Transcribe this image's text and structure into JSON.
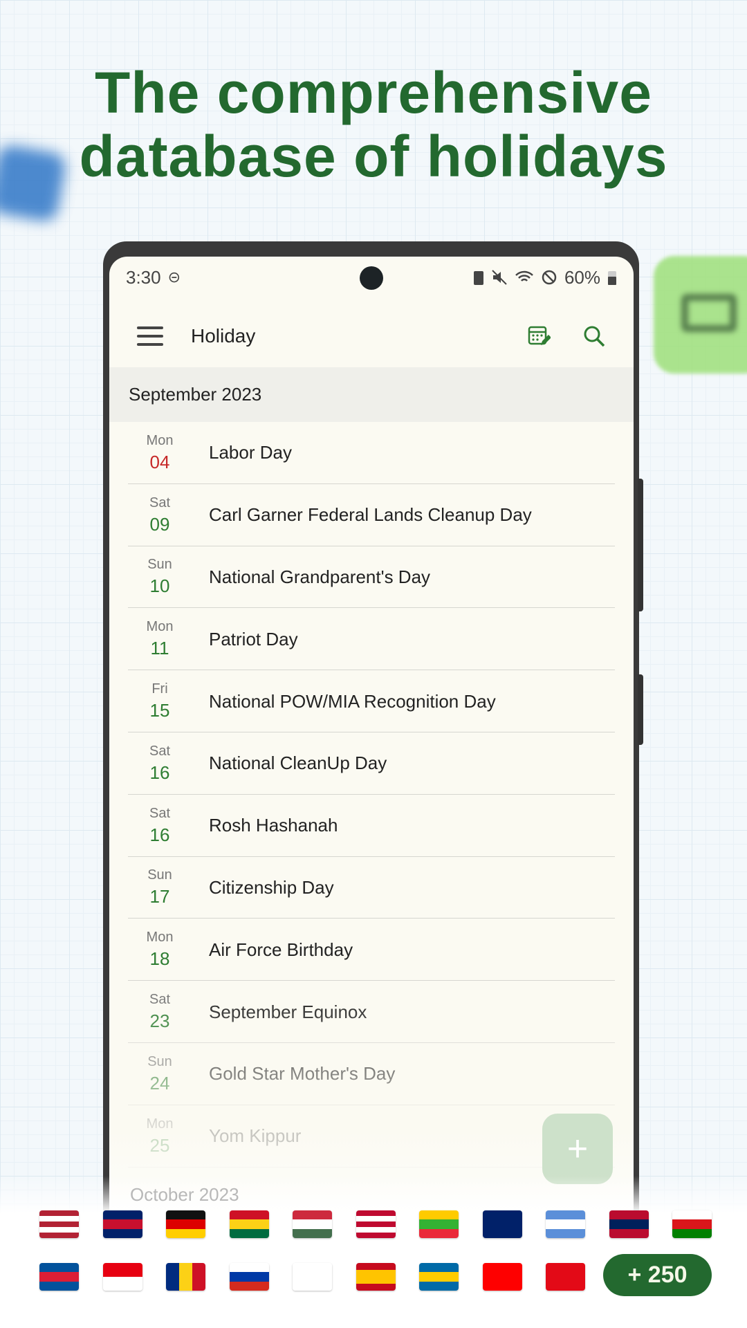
{
  "headline": [
    "The comprehensive",
    "database of holidays"
  ],
  "status": {
    "time": "3:30",
    "battery": "60%"
  },
  "toolbar": {
    "title": "Holiday"
  },
  "section": "September 2023",
  "holidays": [
    {
      "dow": "Mon",
      "day": "04",
      "name": "Labor Day",
      "red": true
    },
    {
      "dow": "Sat",
      "day": "09",
      "name": "Carl Garner Federal Lands Cleanup Day"
    },
    {
      "dow": "Sun",
      "day": "10",
      "name": "National Grandparent's Day"
    },
    {
      "dow": "Mon",
      "day": "11",
      "name": "Patriot Day"
    },
    {
      "dow": "Fri",
      "day": "15",
      "name": "National POW/MIA Recognition Day"
    },
    {
      "dow": "Sat",
      "day": "16",
      "name": "National CleanUp Day"
    },
    {
      "dow": "Sat",
      "day": "16",
      "name": "Rosh Hashanah"
    },
    {
      "dow": "Sun",
      "day": "17",
      "name": "Citizenship Day"
    },
    {
      "dow": "Mon",
      "day": "18",
      "name": "Air Force Birthday"
    },
    {
      "dow": "Sat",
      "day": "23",
      "name": "September Equinox"
    },
    {
      "dow": "Sun",
      "day": "24",
      "name": "Gold Star Mother's Day"
    },
    {
      "dow": "Mon",
      "day": "25",
      "name": "Yom Kippur"
    }
  ],
  "next_section": "October 2023",
  "fab": "+",
  "colors": {
    "accent": "#23692f",
    "weekend_red": "#c62828"
  },
  "flags": [
    [
      {
        "icon": "flag-us",
        "dir": "h",
        "c": [
          "#b22234",
          "#fff",
          "#b22234",
          "#fff",
          "#b22234"
        ]
      },
      {
        "icon": "flag-gb",
        "dir": "h",
        "c": [
          "#012169",
          "#c8102e",
          "#012169"
        ]
      },
      {
        "icon": "flag-de",
        "dir": "h",
        "c": [
          "#111",
          "#dd0000",
          "#ffce00"
        ]
      },
      {
        "icon": "flag-gh",
        "dir": "h",
        "c": [
          "#ce1126",
          "#fcd116",
          "#006b3f"
        ]
      },
      {
        "icon": "flag-hu",
        "dir": "h",
        "c": [
          "#cd2a3e",
          "#fff",
          "#436f4d"
        ]
      },
      {
        "icon": "flag-lr",
        "dir": "h",
        "c": [
          "#bf0a30",
          "#fff",
          "#bf0a30",
          "#fff",
          "#bf0a30"
        ]
      },
      {
        "icon": "flag-mm",
        "dir": "h",
        "c": [
          "#fecb00",
          "#34b233",
          "#ea2839"
        ]
      },
      {
        "icon": "flag-nz",
        "dir": "h",
        "c": [
          "#012169",
          "#012169"
        ]
      },
      {
        "icon": "flag-ni",
        "dir": "h",
        "c": [
          "#5b8fd9",
          "#fff",
          "#5b8fd9"
        ]
      },
      {
        "icon": "flag-no",
        "dir": "h",
        "c": [
          "#ba0c2f",
          "#00205b",
          "#ba0c2f"
        ]
      },
      {
        "icon": "flag-om",
        "dir": "h",
        "c": [
          "#fff",
          "#db161b",
          "#008000"
        ]
      }
    ],
    [
      {
        "icon": "flag-is",
        "dir": "h",
        "c": [
          "#02529c",
          "#dc1e35",
          "#02529c"
        ]
      },
      {
        "icon": "flag-id",
        "dir": "h",
        "c": [
          "#e70011",
          "#fff"
        ]
      },
      {
        "icon": "flag-ro",
        "dir": "v",
        "c": [
          "#002b7f",
          "#fcd116",
          "#ce1126"
        ]
      },
      {
        "icon": "flag-ru",
        "dir": "h",
        "c": [
          "#fff",
          "#0039a6",
          "#d52b1e"
        ]
      },
      {
        "icon": "flag-kr",
        "dir": "h",
        "c": [
          "#fff",
          "#fff"
        ]
      },
      {
        "icon": "flag-es",
        "dir": "h",
        "c": [
          "#c60b1e",
          "#ffc400",
          "#ffc400",
          "#c60b1e"
        ]
      },
      {
        "icon": "flag-se",
        "dir": "h",
        "c": [
          "#006aa7",
          "#fecc00",
          "#006aa7"
        ]
      },
      {
        "icon": "flag-tw",
        "dir": "h",
        "c": [
          "#fe0000",
          "#fe0000"
        ]
      },
      {
        "icon": "flag-tr",
        "dir": "h",
        "c": [
          "#e30a17",
          "#e30a17"
        ]
      }
    ]
  ],
  "more_countries": "+ 250"
}
